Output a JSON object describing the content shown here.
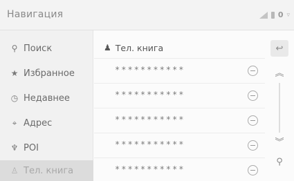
{
  "header": {
    "title": "Навигация",
    "status_count": "0"
  },
  "sidebar": {
    "items": [
      {
        "label": "Поиск",
        "icon": "search-icon",
        "active": false
      },
      {
        "label": "Избранное",
        "icon": "star-icon",
        "active": false
      },
      {
        "label": "Недавнее",
        "icon": "clock-icon",
        "active": false
      },
      {
        "label": "Адрес",
        "icon": "location-icon",
        "active": false
      },
      {
        "label": "POI",
        "icon": "pin-icon",
        "active": false
      },
      {
        "label": "Тел. книга",
        "icon": "person-icon",
        "active": true
      }
    ]
  },
  "main": {
    "section_title": "Тел. книга",
    "entries": [
      {
        "text": "***********"
      },
      {
        "text": "***********"
      },
      {
        "text": "***********"
      },
      {
        "text": "***********"
      },
      {
        "text": "***********"
      }
    ]
  },
  "rail": {
    "back_icon": "back-arrow-icon",
    "up_icon": "double-chevron-up-icon",
    "down_icon": "double-chevron-down-icon",
    "search_icon": "search-icon"
  }
}
